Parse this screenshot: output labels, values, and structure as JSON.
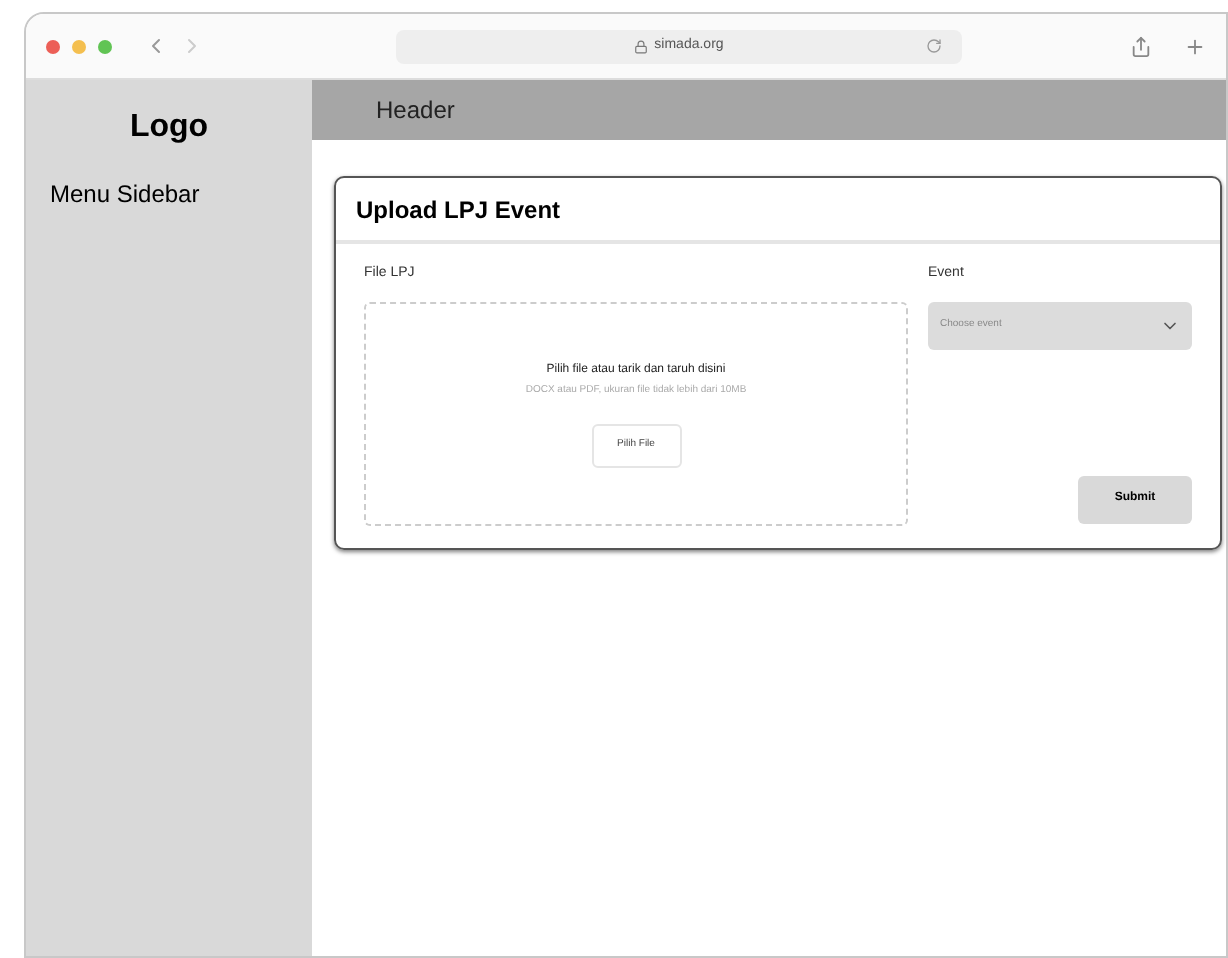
{
  "browser": {
    "url": "simada.org"
  },
  "sidebar": {
    "logo": "Logo",
    "menu": "Menu Sidebar"
  },
  "header": {
    "title": "Header"
  },
  "card": {
    "title": "Upload LPJ Event",
    "file_label": "File LPJ",
    "drop_title": "Pilih file atau tarik dan taruh disini",
    "drop_hint": "DOCX atau PDF, ukuran file tidak lebih dari 10MB",
    "choose_button": "Pilih File",
    "event_label": "Event",
    "event_select": {
      "placeholder": "Choose event"
    },
    "submit": "Submit"
  }
}
